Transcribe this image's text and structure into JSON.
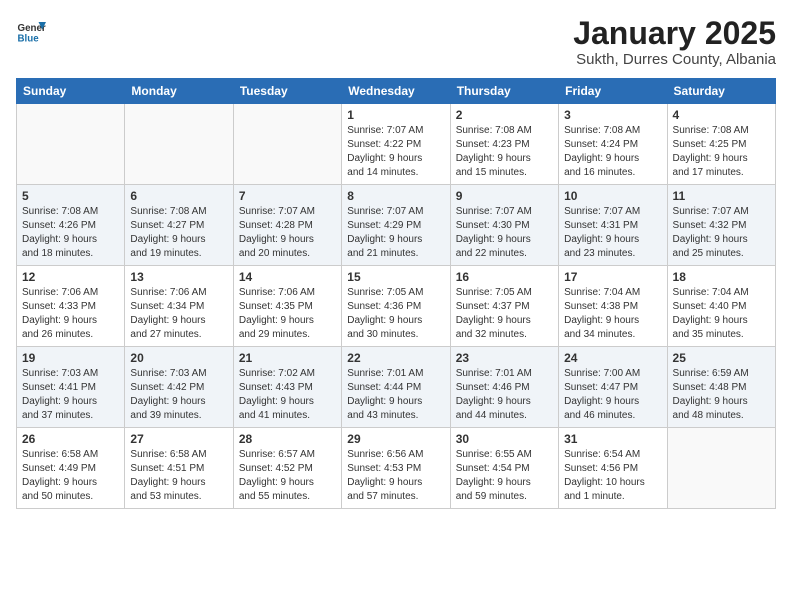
{
  "header": {
    "logo_general": "General",
    "logo_blue": "Blue",
    "title": "January 2025",
    "subtitle": "Sukth, Durres County, Albania"
  },
  "weekdays": [
    "Sunday",
    "Monday",
    "Tuesday",
    "Wednesday",
    "Thursday",
    "Friday",
    "Saturday"
  ],
  "weeks": [
    [
      {
        "day": "",
        "info": ""
      },
      {
        "day": "",
        "info": ""
      },
      {
        "day": "",
        "info": ""
      },
      {
        "day": "1",
        "info": "Sunrise: 7:07 AM\nSunset: 4:22 PM\nDaylight: 9 hours\nand 14 minutes."
      },
      {
        "day": "2",
        "info": "Sunrise: 7:08 AM\nSunset: 4:23 PM\nDaylight: 9 hours\nand 15 minutes."
      },
      {
        "day": "3",
        "info": "Sunrise: 7:08 AM\nSunset: 4:24 PM\nDaylight: 9 hours\nand 16 minutes."
      },
      {
        "day": "4",
        "info": "Sunrise: 7:08 AM\nSunset: 4:25 PM\nDaylight: 9 hours\nand 17 minutes."
      }
    ],
    [
      {
        "day": "5",
        "info": "Sunrise: 7:08 AM\nSunset: 4:26 PM\nDaylight: 9 hours\nand 18 minutes."
      },
      {
        "day": "6",
        "info": "Sunrise: 7:08 AM\nSunset: 4:27 PM\nDaylight: 9 hours\nand 19 minutes."
      },
      {
        "day": "7",
        "info": "Sunrise: 7:07 AM\nSunset: 4:28 PM\nDaylight: 9 hours\nand 20 minutes."
      },
      {
        "day": "8",
        "info": "Sunrise: 7:07 AM\nSunset: 4:29 PM\nDaylight: 9 hours\nand 21 minutes."
      },
      {
        "day": "9",
        "info": "Sunrise: 7:07 AM\nSunset: 4:30 PM\nDaylight: 9 hours\nand 22 minutes."
      },
      {
        "day": "10",
        "info": "Sunrise: 7:07 AM\nSunset: 4:31 PM\nDaylight: 9 hours\nand 23 minutes."
      },
      {
        "day": "11",
        "info": "Sunrise: 7:07 AM\nSunset: 4:32 PM\nDaylight: 9 hours\nand 25 minutes."
      }
    ],
    [
      {
        "day": "12",
        "info": "Sunrise: 7:06 AM\nSunset: 4:33 PM\nDaylight: 9 hours\nand 26 minutes."
      },
      {
        "day": "13",
        "info": "Sunrise: 7:06 AM\nSunset: 4:34 PM\nDaylight: 9 hours\nand 27 minutes."
      },
      {
        "day": "14",
        "info": "Sunrise: 7:06 AM\nSunset: 4:35 PM\nDaylight: 9 hours\nand 29 minutes."
      },
      {
        "day": "15",
        "info": "Sunrise: 7:05 AM\nSunset: 4:36 PM\nDaylight: 9 hours\nand 30 minutes."
      },
      {
        "day": "16",
        "info": "Sunrise: 7:05 AM\nSunset: 4:37 PM\nDaylight: 9 hours\nand 32 minutes."
      },
      {
        "day": "17",
        "info": "Sunrise: 7:04 AM\nSunset: 4:38 PM\nDaylight: 9 hours\nand 34 minutes."
      },
      {
        "day": "18",
        "info": "Sunrise: 7:04 AM\nSunset: 4:40 PM\nDaylight: 9 hours\nand 35 minutes."
      }
    ],
    [
      {
        "day": "19",
        "info": "Sunrise: 7:03 AM\nSunset: 4:41 PM\nDaylight: 9 hours\nand 37 minutes."
      },
      {
        "day": "20",
        "info": "Sunrise: 7:03 AM\nSunset: 4:42 PM\nDaylight: 9 hours\nand 39 minutes."
      },
      {
        "day": "21",
        "info": "Sunrise: 7:02 AM\nSunset: 4:43 PM\nDaylight: 9 hours\nand 41 minutes."
      },
      {
        "day": "22",
        "info": "Sunrise: 7:01 AM\nSunset: 4:44 PM\nDaylight: 9 hours\nand 43 minutes."
      },
      {
        "day": "23",
        "info": "Sunrise: 7:01 AM\nSunset: 4:46 PM\nDaylight: 9 hours\nand 44 minutes."
      },
      {
        "day": "24",
        "info": "Sunrise: 7:00 AM\nSunset: 4:47 PM\nDaylight: 9 hours\nand 46 minutes."
      },
      {
        "day": "25",
        "info": "Sunrise: 6:59 AM\nSunset: 4:48 PM\nDaylight: 9 hours\nand 48 minutes."
      }
    ],
    [
      {
        "day": "26",
        "info": "Sunrise: 6:58 AM\nSunset: 4:49 PM\nDaylight: 9 hours\nand 50 minutes."
      },
      {
        "day": "27",
        "info": "Sunrise: 6:58 AM\nSunset: 4:51 PM\nDaylight: 9 hours\nand 53 minutes."
      },
      {
        "day": "28",
        "info": "Sunrise: 6:57 AM\nSunset: 4:52 PM\nDaylight: 9 hours\nand 55 minutes."
      },
      {
        "day": "29",
        "info": "Sunrise: 6:56 AM\nSunset: 4:53 PM\nDaylight: 9 hours\nand 57 minutes."
      },
      {
        "day": "30",
        "info": "Sunrise: 6:55 AM\nSunset: 4:54 PM\nDaylight: 9 hours\nand 59 minutes."
      },
      {
        "day": "31",
        "info": "Sunrise: 6:54 AM\nSunset: 4:56 PM\nDaylight: 10 hours\nand 1 minute."
      },
      {
        "day": "",
        "info": ""
      }
    ]
  ]
}
